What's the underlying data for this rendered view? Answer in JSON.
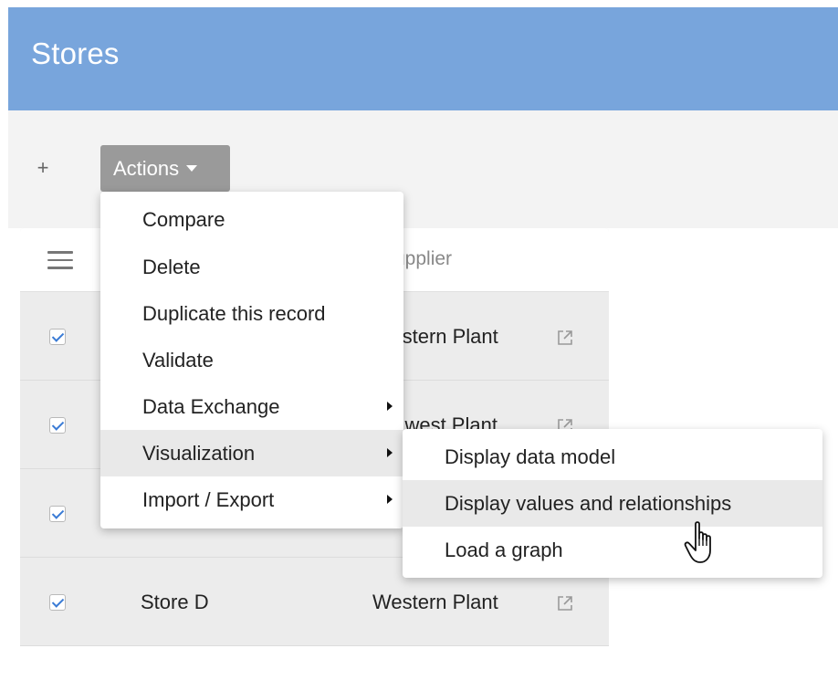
{
  "header": {
    "title": "Stores"
  },
  "toolbar": {
    "add_label": "+",
    "actions_label": "Actions"
  },
  "table": {
    "supplier_header": "Supplier",
    "rows": [
      {
        "name": "",
        "supplier": "Western Plant",
        "checked": true
      },
      {
        "name": "",
        "supplier": "Midwest Plant",
        "checked": true
      },
      {
        "name": "",
        "supplier": "",
        "checked": true
      },
      {
        "name": "Store D",
        "supplier": "Western Plant",
        "checked": true
      }
    ]
  },
  "actions_menu": {
    "items": [
      {
        "label": "Compare",
        "has_submenu": false
      },
      {
        "label": "Delete",
        "has_submenu": false
      },
      {
        "label": "Duplicate this record",
        "has_submenu": false
      },
      {
        "label": "Validate",
        "has_submenu": false
      },
      {
        "label": "Data Exchange",
        "has_submenu": true
      },
      {
        "label": "Visualization",
        "has_submenu": true,
        "active": true
      },
      {
        "label": "Import / Export",
        "has_submenu": true
      }
    ]
  },
  "visualization_submenu": {
    "items": [
      {
        "label": "Display data model"
      },
      {
        "label": "Display values and relationships",
        "hovered": true
      },
      {
        "label": "Load a graph"
      }
    ]
  },
  "colors": {
    "header_bg": "#78a5dc",
    "actions_bg": "#9a9a9a",
    "checkbox_accent": "#3a7bd5"
  },
  "icons": {
    "add": "plus-icon",
    "caret": "caret-down-icon",
    "column_menu": "hamburger-menu-icon",
    "external_link": "external-link-icon",
    "submenu_arrow": "chevron-right-icon",
    "cursor": "hand-pointer-cursor-icon"
  }
}
